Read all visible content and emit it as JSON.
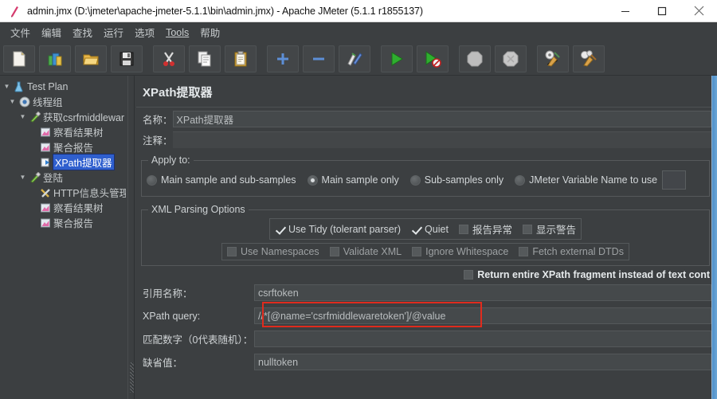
{
  "window": {
    "title": "admin.jmx (D:\\jmeter\\apache-jmeter-5.1.1\\bin\\admin.jmx) - Apache JMeter (5.1.1 r1855137)",
    "app_icon": "jmeter-feather-icon",
    "minimize": "—",
    "maximize": "☐",
    "close": "✕"
  },
  "menubar": {
    "items": [
      {
        "label": "文件",
        "name": "menu-file"
      },
      {
        "label": "编辑",
        "name": "menu-edit"
      },
      {
        "label": "查找",
        "name": "menu-search"
      },
      {
        "label": "运行",
        "name": "menu-run"
      },
      {
        "label": "选项",
        "name": "menu-options"
      },
      {
        "label": "Tools",
        "name": "menu-tools"
      },
      {
        "label": "帮助",
        "name": "menu-help"
      }
    ]
  },
  "toolbar": {
    "buttons": [
      {
        "name": "new-button",
        "icon": "new-document-icon"
      },
      {
        "name": "templates-button",
        "icon": "templates-icon"
      },
      {
        "name": "open-button",
        "icon": "open-folder-icon"
      },
      {
        "name": "save-button",
        "icon": "floppy-save-icon"
      },
      {
        "name": "cut-button",
        "icon": "scissors-icon"
      },
      {
        "name": "copy-button",
        "icon": "copy-icon"
      },
      {
        "name": "paste-button",
        "icon": "clipboard-paste-icon"
      },
      {
        "name": "expand-all-button",
        "icon": "plus-icon"
      },
      {
        "name": "collapse-all-button",
        "icon": "minus-icon"
      },
      {
        "name": "toggle-button",
        "icon": "toggle-pencil-icon"
      },
      {
        "name": "start-button",
        "icon": "green-play-icon"
      },
      {
        "name": "start-no-pauses-button",
        "icon": "green-play-no-pause-icon"
      },
      {
        "name": "stop-button",
        "icon": "stop-octagon-icon"
      },
      {
        "name": "shutdown-button",
        "icon": "shutdown-icon"
      },
      {
        "name": "clear-button",
        "icon": "clear-broom-icon"
      },
      {
        "name": "clear-all-button",
        "icon": "clear-all-broom-icon"
      }
    ]
  },
  "tree": {
    "nodes": [
      {
        "label": "Test Plan",
        "icon": "test-plan-icon",
        "indent": 0,
        "arrow": "down",
        "selected": false,
        "name": "tree-node-test-plan"
      },
      {
        "label": "线程组",
        "icon": "thread-group-gear-icon",
        "indent": 1,
        "arrow": "down",
        "selected": false,
        "name": "tree-node-thread-group"
      },
      {
        "label": "获取csrfmiddlewar",
        "icon": "http-request-icon",
        "indent": 2,
        "arrow": "down",
        "selected": false,
        "name": "tree-node-get-csrf"
      },
      {
        "label": "察看结果树",
        "icon": "view-results-tree-icon",
        "indent": 3,
        "arrow": "none",
        "selected": false,
        "name": "tree-node-view-results-tree-1"
      },
      {
        "label": "聚合报告",
        "icon": "aggregate-report-icon",
        "indent": 3,
        "arrow": "none",
        "selected": false,
        "name": "tree-node-aggregate-report-1"
      },
      {
        "label": "XPath提取器",
        "icon": "xpath-extractor-icon",
        "indent": 3,
        "arrow": "none",
        "selected": true,
        "name": "tree-node-xpath-extractor"
      },
      {
        "label": "登陆",
        "icon": "http-request-icon",
        "indent": 2,
        "arrow": "down",
        "selected": false,
        "name": "tree-node-login"
      },
      {
        "label": "HTTP信息头管理",
        "icon": "header-manager-icon",
        "indent": 3,
        "arrow": "none",
        "selected": false,
        "name": "tree-node-header-manager"
      },
      {
        "label": "察看结果树",
        "icon": "view-results-tree-icon",
        "indent": 3,
        "arrow": "none",
        "selected": false,
        "name": "tree-node-view-results-tree-2"
      },
      {
        "label": "聚合报告",
        "icon": "aggregate-report-icon",
        "indent": 3,
        "arrow": "none",
        "selected": false,
        "name": "tree-node-aggregate-report-2"
      }
    ]
  },
  "panel": {
    "title": "XPath提取器",
    "name_label": "名称：",
    "name_value": "XPath提取器",
    "comment_label": "注释：",
    "comment_value": "",
    "apply_to": {
      "legend": "Apply to:",
      "options": [
        {
          "label": "Main sample and sub-samples",
          "selected": false,
          "name": "radio-main-and-sub"
        },
        {
          "label": "Main sample only",
          "selected": true,
          "name": "radio-main-only"
        },
        {
          "label": "Sub-samples only",
          "selected": false,
          "name": "radio-sub-only"
        },
        {
          "label": "JMeter Variable Name to use",
          "selected": false,
          "name": "radio-jmeter-variable"
        }
      ],
      "variable_value": ""
    },
    "xml_parsing": {
      "legend": "XML Parsing Options",
      "row1": [
        {
          "label": "Use Tidy (tolerant parser)",
          "checked": true,
          "name": "checkbox-use-tidy"
        },
        {
          "label": "Quiet",
          "checked": true,
          "name": "checkbox-quiet"
        },
        {
          "label": "报告异常",
          "checked": false,
          "name": "checkbox-report-errors"
        },
        {
          "label": "显示警告",
          "checked": false,
          "name": "checkbox-show-warnings"
        }
      ],
      "row2": [
        {
          "label": "Use Namespaces",
          "checked": false,
          "name": "checkbox-use-namespaces"
        },
        {
          "label": "Validate XML",
          "checked": false,
          "name": "checkbox-validate-xml"
        },
        {
          "label": "Ignore Whitespace",
          "checked": false,
          "name": "checkbox-ignore-whitespace"
        },
        {
          "label": "Fetch external DTDs",
          "checked": false,
          "name": "checkbox-fetch-external-dtds"
        }
      ]
    },
    "return_fragment": {
      "label": "Return entire XPath fragment instead of text cont",
      "checked": false
    },
    "fields": [
      {
        "label": "引用名称：",
        "value": "csrftoken",
        "name": "reference-name"
      },
      {
        "label": "XPath query:",
        "value": "//*[@name='csrfmiddlewaretoken']/@value",
        "name": "xpath-query"
      },
      {
        "label": "匹配数字（0代表随机）：",
        "value": "",
        "name": "match-number"
      },
      {
        "label": "缺省值：",
        "value": "nulltoken",
        "name": "default-value"
      }
    ]
  },
  "colors": {
    "background": "#3c3f41",
    "titlebar": "#ffffff",
    "selection": "#2f5fce",
    "highlight_box": "#e02b1d",
    "text": "#c6cacc"
  }
}
